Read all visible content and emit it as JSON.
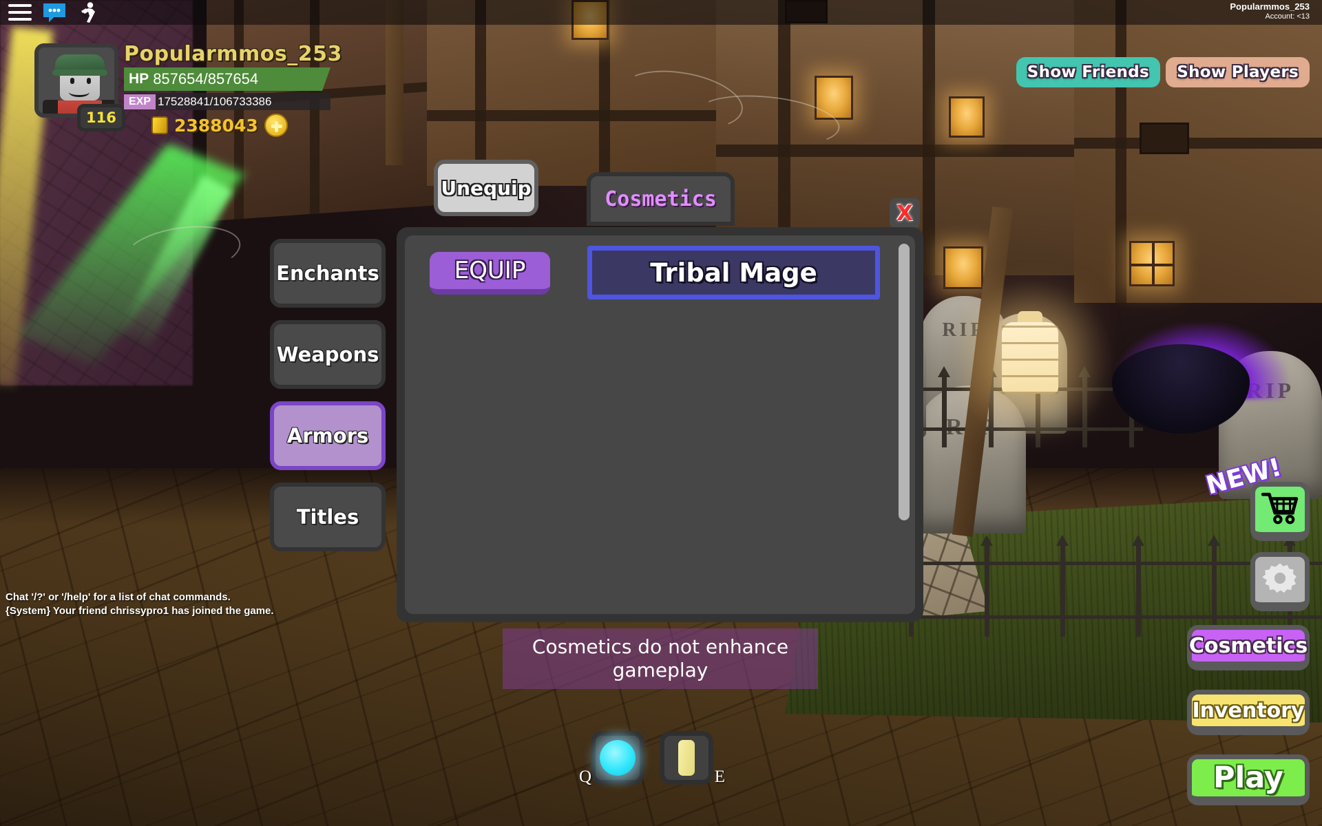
{
  "topbar": {
    "menu_icon": "hamburger-menu-icon",
    "chat_icon": "chat-bubble-icon",
    "emote_icon": "running-person-icon",
    "account_name": "Popularmmos_253",
    "account_age": "Account: <13"
  },
  "hud": {
    "player_name": "Popularmmos_253",
    "level": "116",
    "hp_label": "HP",
    "hp_value": "857654/857654",
    "exp_label": "EXP",
    "exp_value": "17528841/106733386",
    "gold_value": "2388043",
    "coin_icon": "gold-coin-icon",
    "add_gold_icon": "plus-icon"
  },
  "social": {
    "show_friends": "Show Friends",
    "show_players": "Show Players",
    "friends_color": "#43c5b0",
    "players_color": "#e0ab8f"
  },
  "tabs": [
    {
      "label": "Enchants",
      "active": false
    },
    {
      "label": "Weapons",
      "active": false
    },
    {
      "label": "Armors",
      "active": true
    },
    {
      "label": "Titles",
      "active": false
    }
  ],
  "panel": {
    "unequip_label": "Unequip",
    "header_tab": "Cosmetics",
    "close_label": "X",
    "equip_label": "EQUIP",
    "items": [
      {
        "name": "Tribal Mage",
        "selected": true
      }
    ],
    "scrollbar": "vertical-scrollbar"
  },
  "notice": {
    "text": "Cosmetics do not enhance gameplay"
  },
  "chat": {
    "lines": [
      "Chat '/?' or '/help' for a list of chat commands.",
      "{System} Your friend chrissypro1 has joined the game."
    ]
  },
  "hotbar": {
    "slots": [
      {
        "key": "Q",
        "icon": "cyan-orb-icon"
      },
      {
        "key": "E",
        "icon": "yellow-potion-icon"
      }
    ]
  },
  "actions": {
    "shop_icon": "shopping-cart-icon",
    "new_badge": "NEW!",
    "settings_icon": "gear-icon",
    "cosmetics": "Cosmetics",
    "inventory": "Inventory",
    "play": "Play",
    "shop_color": "#72ea74",
    "cosmetics_color": "#c762f5",
    "inventory_color": "#f7e36f",
    "play_color": "#7ded4b"
  }
}
